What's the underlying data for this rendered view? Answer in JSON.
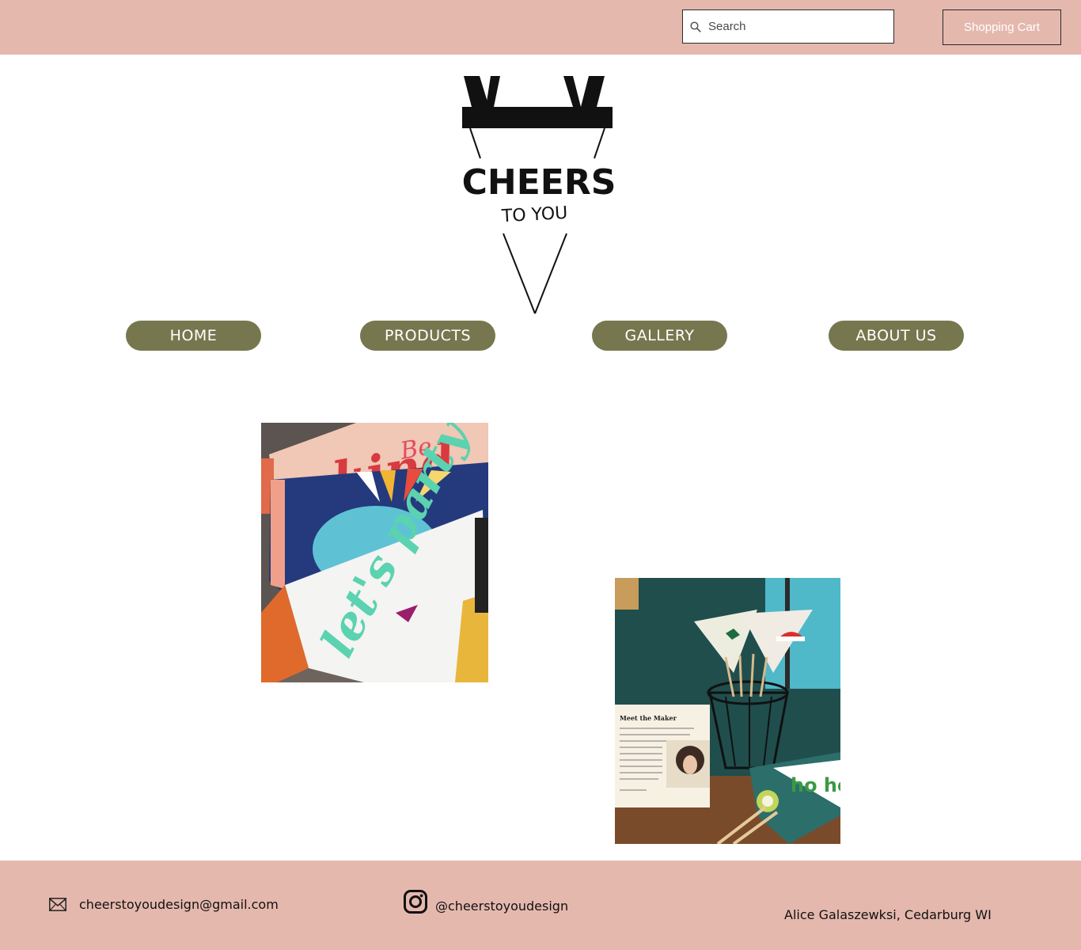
{
  "header": {
    "search": {
      "placeholder": "Search",
      "icon": "search-icon"
    },
    "cart_label": "Shopping Cart"
  },
  "logo": {
    "title": "CHEERS",
    "subtitle": "TO YOU"
  },
  "nav": {
    "items": [
      {
        "label": "HOME"
      },
      {
        "label": "PRODUCTS"
      },
      {
        "label": "GALLERY"
      },
      {
        "label": "ABOUT US"
      }
    ]
  },
  "gallery": {
    "photo1": {
      "text_top": "Be",
      "text_mid": "kind",
      "text_script": "let's party"
    },
    "photo2": {
      "card_title": "Meet the Maker"
    }
  },
  "footer": {
    "email": "cheerstoyoudesign@gmail.com",
    "instagram": "@cheerstoyoudesign",
    "location": "Alice Galaszewksi, Cedarburg WI"
  },
  "colors": {
    "header_bg": "#e5b8ae",
    "nav_bg": "#77774f",
    "footer_bg": "#e5b8ae"
  }
}
